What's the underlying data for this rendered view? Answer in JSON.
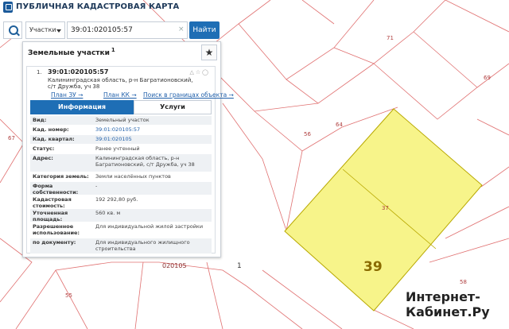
{
  "app": {
    "title": "ПУБЛИЧНАЯ КАДАСТРОВАЯ КАРТА"
  },
  "search": {
    "type": "Участки",
    "value": "39:01:020105:57",
    "clear": "×",
    "button": "Найти"
  },
  "panel": {
    "title": "Земельные участки",
    "count": "1",
    "favorite": "★",
    "result": {
      "number": "1.",
      "cad": "39:01:020105:57",
      "address": "Калининградская область, р-н Багратионовский, с/т Дружба, уч 38",
      "tools": "△☆◯",
      "links": {
        "plan_zu": "План ЗУ →",
        "plan_kk": "План КК →",
        "search_bounds": "Поиск в границах объекта →"
      },
      "tabs": {
        "info": "Информация",
        "services": "Услуги"
      },
      "attributes": [
        {
          "key": "Вид:",
          "value": "Земельный участок",
          "blue": false
        },
        {
          "key": "Кад. номер:",
          "value": "39:01:020105:57",
          "blue": true
        },
        {
          "key": "Кад. квартал:",
          "value": "39:01:020105",
          "blue": true
        },
        {
          "key": "Статус:",
          "value": "Ранее учтенный",
          "blue": false
        },
        {
          "key": "Адрес:",
          "value": "Калининградская область, р-н Багратионовский, с/т Дружба, уч 38",
          "blue": false
        },
        {
          "key": "Категория земель:",
          "value": "Земли населённых пунктов",
          "blue": false
        },
        {
          "key": "Форма собственности:",
          "value": "-",
          "blue": false
        },
        {
          "key": "Кадастровая стоимость:",
          "value": "192 292,80 руб.",
          "blue": false
        },
        {
          "key": "Уточненная площадь:",
          "value": "560 кв. м",
          "blue": false
        },
        {
          "key": "Разрешенное использование:",
          "value": "Для индивидуальной жилой застройки",
          "blue": false
        },
        {
          "key": "по документу:",
          "value": "Для индивидуального жилищного строительства",
          "blue": false
        }
      ]
    }
  },
  "map": {
    "labels": {
      "l71": "71",
      "l69": "69",
      "l64": "64",
      "l56": "56",
      "l67": "67",
      "l37": "37",
      "l58": "58",
      "l55": "55",
      "l020105": "020105",
      "l1": "1"
    },
    "big_number": "39",
    "selected_fill": "#f7f48a",
    "line_color": "#e06060"
  },
  "watermark": {
    "line1": "Интернет-",
    "line2": "Кабинет.Ру"
  }
}
